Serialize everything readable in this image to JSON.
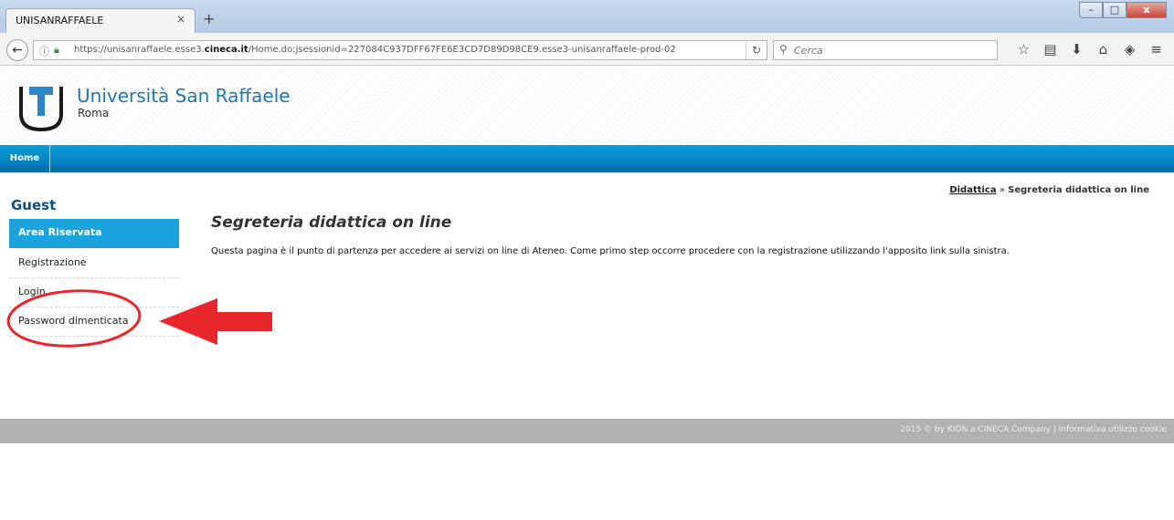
{
  "browser": {
    "tab_title": "UNISANRAFFAELE",
    "tab_close": "×",
    "new_tab": "+",
    "url_prefix": "https://unisanraffaele.esse3.",
    "url_domain": "cineca.it",
    "url_suffix": "/Home.do;jsessionid=227084C937DFF67FE6E3CD7D89D98CE9.esse3-unisanraffaele-prod-02",
    "search_placeholder": "Cerca",
    "toolbar_icons": [
      "star-icon",
      "reading-list-icon",
      "download-icon",
      "home-icon",
      "pocket-icon",
      "menu-icon"
    ]
  },
  "header": {
    "brand_name": "Università San Raffaele",
    "brand_city": "Roma",
    "brand_color": "#1f77b4"
  },
  "nav": {
    "home_label": "Home",
    "bar_color": "#0584c3"
  },
  "sidebar": {
    "heading": "Guest",
    "items": [
      {
        "label": "Area Riservata",
        "active": true
      },
      {
        "label": "Registrazione",
        "active": false
      },
      {
        "label": "Login",
        "active": false
      },
      {
        "label": "Password dimenticata",
        "active": false
      }
    ]
  },
  "breadcrumb": {
    "link": "Didattica",
    "separator": "»",
    "current": "Segreteria didattica on line"
  },
  "main": {
    "title": "Segreteria didattica on line",
    "description": "Questa pagina è il punto di partenza per accedere ai servizi on line di Ateneo. Come primo step occorre procedere con la registrazione utilizzando l'apposito link sulla sinistra."
  },
  "footer": {
    "text": "2015 © by KION a CINECA Company | Informativa utilizzo cookie"
  },
  "annotation_color": "#e8262c"
}
